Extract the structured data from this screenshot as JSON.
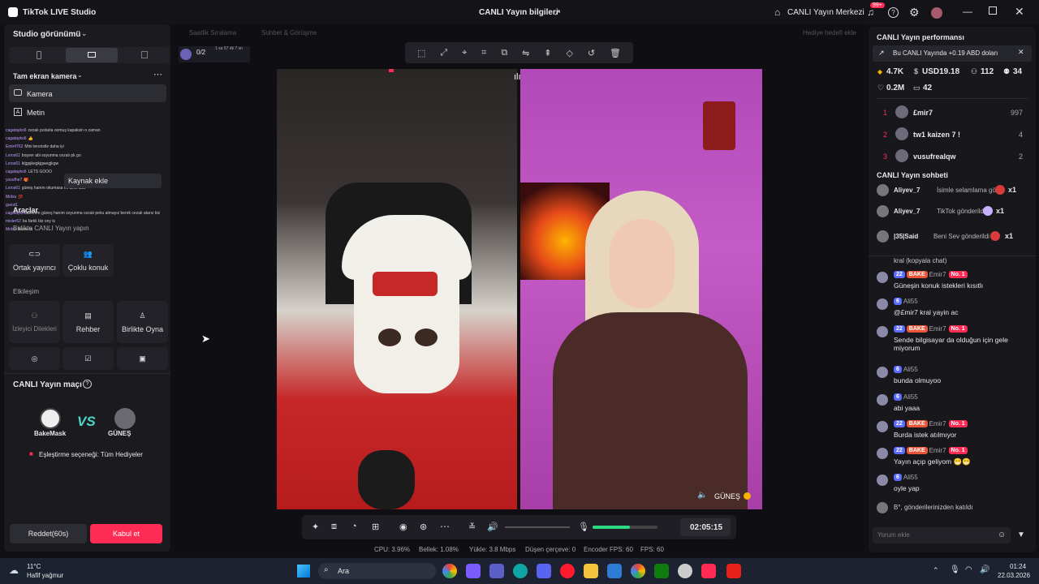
{
  "app": {
    "title": "TikTok LIVE Studio",
    "center_title": "CANLI Yayın bilgileri",
    "live_center": "CANLI Yayın Merkezi",
    "notif_count": "99+"
  },
  "left": {
    "studio_view": "Studio görünümü",
    "scene_title": "Tam ekran kamera",
    "sources": [
      "Kamera",
      "Metin"
    ],
    "add_source": "Kaynak ekle",
    "tools_title": "Araçlar",
    "live_together": "Birlikte CANLI Yayın yapın",
    "tiles1": [
      "Ortak yayıncı",
      "Çoklu konuk"
    ],
    "interaction": "Etkileşim",
    "tiles2": [
      "İzleyici Dilekleri",
      "Rehber",
      "Birlikte Oyna"
    ],
    "match_title": "CANLI Yayın maçı",
    "p1": "BakeMask",
    "p2": "GÜNEŞ",
    "match_option": "Eşleştirme seçeneği: Tüm Hediyeler",
    "reject": "Reddet(60s)",
    "accept": "Kabul et",
    "chat": [
      {
        "n": "cagatayko6",
        "t": "cezalı pıstarla oomuş kapaksin o zaman"
      },
      {
        "n": "cagatayko6",
        "t": "👍"
      },
      {
        "n": "Emir4762",
        "t": "Mini teroristle daha iyi"
      },
      {
        "n": "Lınos61",
        "t": "boşver abi soyunma cezalı pk go"
      },
      {
        "n": "Lınos61",
        "t": "ktjgpjkegkjgwegjkgw"
      },
      {
        "n": "cagatayko6",
        "t": "LETS GOOO"
      },
      {
        "n": "yusufhe7",
        "t": "🎁"
      },
      {
        "n": "Lınos61",
        "t": "güneş hanım okumasa mı artık ücü"
      },
      {
        "n": "Molsu",
        "t": "💯"
      },
      {
        "n": "guest1",
        "t": ""
      },
      {
        "n": "cagatayko6",
        "t": "lekrem güneş hanım soyunma cezalı peku atmayız berek cezalı atarız biz"
      },
      {
        "n": "misler52",
        "t": "bu farklı biz ony is"
      },
      {
        "n": "Molsu",
        "t": "bu ne la"
      }
    ]
  },
  "stage": {
    "tabs": [
      "Saatlik Sıralama",
      "Sohbet & Görüşme"
    ],
    "goal": "Hediye hedefi ekle",
    "counter": "0/2",
    "counter_sub": "1 sa 57 dk 7 sn",
    "guest_name": "GÜNEŞ",
    "timer": "02:05:15",
    "stats": [
      "CPU: 3.96%",
      "Bellek: 1.08%",
      "Yükle: 3.8 Mbps",
      "Düşen çerçeve: 0",
      "Encoder FPS: 60",
      "FPS: 60"
    ]
  },
  "right": {
    "perf_title": "CANLI Yayın performansı",
    "banner": "Bu CANLI Yayında +0.19 ABD doları",
    "m1": "4.7K",
    "m2": "USD19.18",
    "m3": "112",
    "m4": "34",
    "m5": "0.2M",
    "m6": "42",
    "ranks": [
      {
        "r": "1",
        "n": "£mir7",
        "v": "997"
      },
      {
        "r": "2",
        "n": "tw1 kaizen 7 !",
        "v": "4"
      },
      {
        "r": "3",
        "n": "vusufrealqw",
        "v": "2"
      }
    ],
    "chat_title": "CANLI Yayın sohbeti",
    "gifts": [
      {
        "n": "Aliyev_7",
        "t": "İsimle selamlama gör",
        "x": "x1"
      },
      {
        "n": "Aliyev_7",
        "t": "TikTok gönderildi",
        "x": "x1"
      },
      {
        "n": "|35|Said",
        "t": "Beni Sev gönderildi",
        "x": "x1"
      }
    ],
    "trunc": "kral (kopyala chat)",
    "messages": [
      {
        "u": "Emir7",
        "l": "22",
        "b": "BAKE",
        "no": "No. 1",
        "t": "Güneşin konuk istekleri kısıtlı"
      },
      {
        "u": "Ali55",
        "l": "6",
        "t": "@£mir7 kral yayin ac"
      },
      {
        "u": "Emir7",
        "l": "22",
        "b": "BAKE",
        "no": "No. 1",
        "t": "Sende bilgisayar da olduğun için gele miyorum"
      },
      {
        "u": "Ali55",
        "l": "6",
        "t": "bunda olmuyoo"
      },
      {
        "u": "Ali55",
        "l": "6",
        "t": "abi yaaa"
      },
      {
        "u": "Emir7",
        "l": "22",
        "b": "BAKE",
        "no": "No. 1",
        "t": "Burda istek atılmıyor"
      },
      {
        "u": "Emir7",
        "l": "22",
        "b": "BAKE",
        "no": "No. 1",
        "t": "Yayın açıp geliyom 😁😁"
      },
      {
        "u": "Ali55",
        "l": "6",
        "t": "oyle yap"
      }
    ],
    "joined": "B°, gönderilerinizden katıldı",
    "comment_placeholder": "Yorum ekle"
  },
  "taskbar": {
    "weather_temp": "11°C",
    "weather_desc": "Hafif yağmur",
    "search": "Ara",
    "time": "01:24",
    "date": "22.03.2026"
  },
  "colors": {
    "accent": "#fe2c55",
    "level": "#5b6bff",
    "bake": "#e8563a"
  }
}
